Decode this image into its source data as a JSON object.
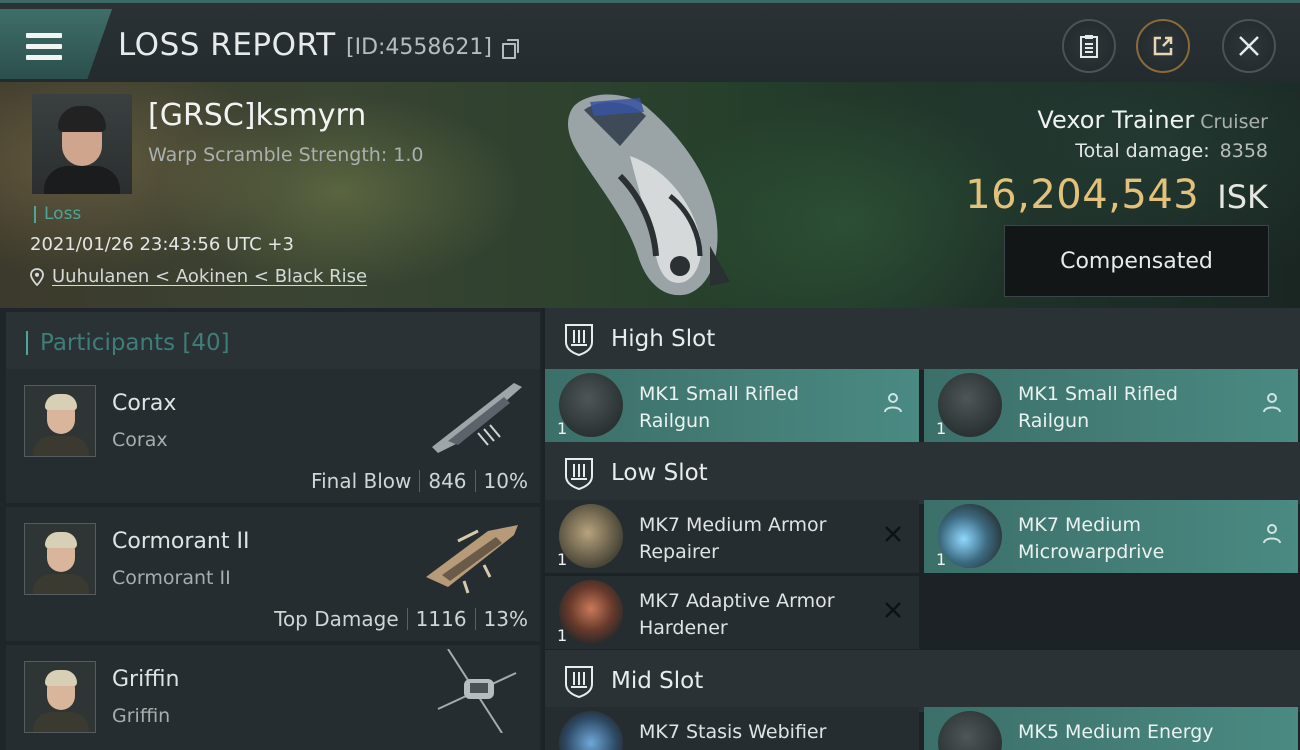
{
  "header": {
    "title": "LOSS REPORT",
    "report_id": "[ID:4558621]"
  },
  "victim": {
    "name": "[GRSC]ksmyrn",
    "warp_scramble": "Warp Scramble Strength: 1.0",
    "tag": "Loss",
    "datetime": "2021/01/26 23:43:56 UTC +3",
    "location": "Uuhulanen < Aokinen < Black Rise",
    "ship_name": "Vexor Trainer",
    "ship_class": "Cruiser",
    "total_damage_label": "Total damage:",
    "total_damage": "8358",
    "isk_value": "16,204,543",
    "isk_unit": "ISK",
    "compensated_label": "Compensated"
  },
  "participants": {
    "label": "Participants",
    "count": "[40]",
    "items": [
      {
        "name": "Corax",
        "ship": "Corax",
        "role": "Final Blow",
        "damage": "846",
        "percent": "10%"
      },
      {
        "name": "Cormorant II",
        "ship": "Cormorant II",
        "role": "Top Damage",
        "damage": "1116",
        "percent": "13%"
      },
      {
        "name": "Griffin",
        "ship": "Griffin",
        "role": "",
        "damage": "",
        "percent": ""
      }
    ]
  },
  "fitting": {
    "high_slot": {
      "label": "High Slot",
      "modules": [
        {
          "name": "MK1 Small Rifled Railgun",
          "qty": "1",
          "state": "destroyed-teal"
        },
        {
          "name": "MK1 Small Rifled Railgun",
          "qty": "1",
          "state": "destroyed-teal"
        }
      ]
    },
    "low_slot": {
      "label": "Low Slot",
      "modules": [
        {
          "name": "MK7 Medium Armor Repairer",
          "qty": "1",
          "state": "lost"
        },
        {
          "name": "MK7 Medium Microwarpdrive",
          "qty": "1",
          "state": "dropped"
        },
        {
          "name": "MK7 Adaptive Armor Hardener",
          "qty": "1",
          "state": "lost"
        }
      ]
    },
    "mid_slot": {
      "label": "Mid Slot",
      "modules": [
        {
          "name": "MK7 Stasis Webifier",
          "qty": "",
          "state": "lost"
        },
        {
          "name": "MK5 Medium Energy",
          "qty": "",
          "state": "dropped"
        }
      ]
    }
  },
  "colors": {
    "accent_teal": "#4fa49b",
    "isk_gold": "#e2c27a",
    "panel": "#262d31"
  }
}
